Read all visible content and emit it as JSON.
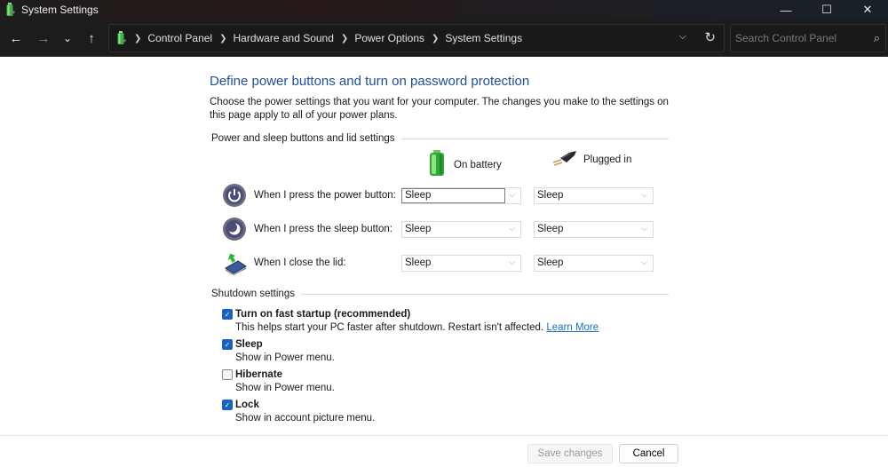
{
  "window": {
    "title": "System Settings",
    "controls": {
      "minimize": "—",
      "maximize": "☐",
      "close": "✕"
    }
  },
  "navigation": {
    "back": "←",
    "forward": "→",
    "recent": "⌄",
    "up": "↑",
    "breadcrumbs": [
      {
        "label": "Control Panel"
      },
      {
        "label": "Hardware and Sound"
      },
      {
        "label": "Power Options"
      },
      {
        "label": "System Settings"
      }
    ],
    "search_placeholder": "Search Control Panel",
    "search_value": ""
  },
  "page": {
    "title": "Define power buttons and turn on password protection",
    "description": "Choose the power settings that you want for your computer. The changes you make to the settings on this page apply to all of your power plans.",
    "power_section": {
      "header": "Power and sleep buttons and lid settings",
      "columns": [
        {
          "label": "On battery",
          "icon": "battery-icon"
        },
        {
          "label": "Plugged in",
          "icon": "power-plug-icon"
        }
      ],
      "rows": [
        {
          "label": "When I press the power button:",
          "icon": "power-button-icon",
          "on_battery": "Sleep",
          "plugged_in": "Sleep"
        },
        {
          "label": "When I press the sleep button:",
          "icon": "sleep-button-icon",
          "on_battery": "Sleep",
          "plugged_in": "Sleep"
        },
        {
          "label": "When I close the lid:",
          "icon": "laptop-lid-icon",
          "on_battery": "Sleep",
          "plugged_in": "Sleep"
        }
      ]
    },
    "shutdown_section": {
      "header": "Shutdown settings",
      "items": [
        {
          "label": "Turn on fast startup (recommended)",
          "checked": true,
          "description": "This helps start your PC faster after shutdown. Restart isn't affected.",
          "link": "Learn More"
        },
        {
          "label": "Sleep",
          "checked": true,
          "description": "Show in Power menu."
        },
        {
          "label": "Hibernate",
          "checked": false,
          "description": "Show in Power menu."
        },
        {
          "label": "Lock",
          "checked": true,
          "description": "Show in account picture menu."
        }
      ]
    }
  },
  "footer": {
    "save_label": "Save changes",
    "cancel_label": "Cancel"
  },
  "colors": {
    "title_blue": "#1e4e9c",
    "link_blue": "#1a6fc9",
    "checkbox_blue": "#1664c0"
  }
}
